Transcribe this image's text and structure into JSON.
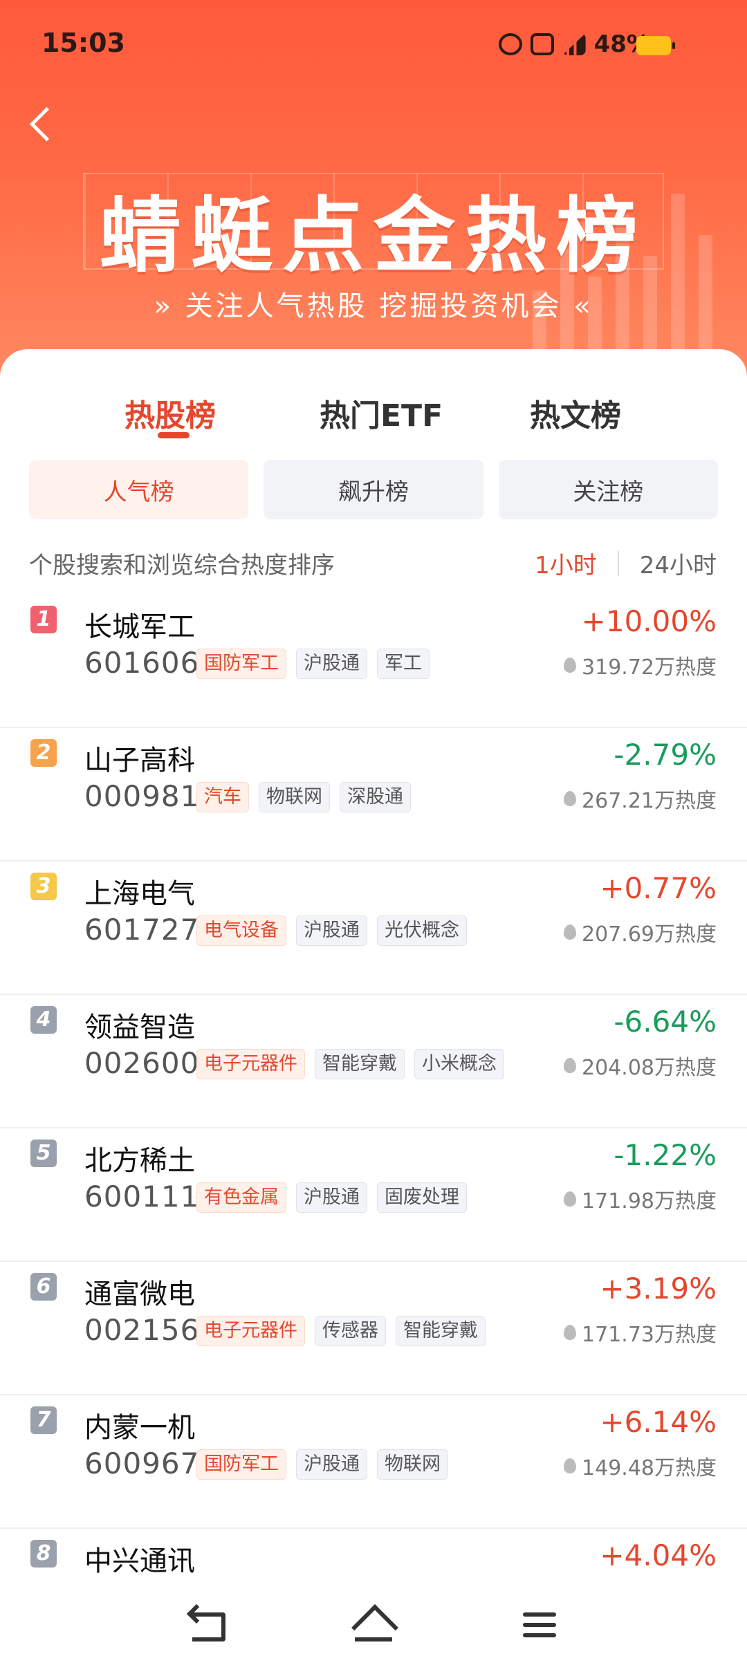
{
  "status_bar": {
    "time": "15:03",
    "battery": "48%",
    "icons": [
      "alarm-icon",
      "hd-icon",
      "4g-signal-icon",
      "battery-icon"
    ]
  },
  "banner": {
    "title": "蜻蜓点金热榜",
    "subtitle": "» 关注人气热股 挖掘投资机会 «"
  },
  "main_tabs": [
    {
      "label": "热股榜",
      "active": true
    },
    {
      "label": "热门ETF",
      "active": false
    },
    {
      "label": "热文榜",
      "active": false
    }
  ],
  "sub_tabs": [
    {
      "label": "人气榜",
      "active": true
    },
    {
      "label": "飙升榜",
      "active": false
    },
    {
      "label": "关注榜",
      "active": false
    }
  ],
  "description": "个股搜索和浏览综合热度排序",
  "time_range": {
    "options": [
      "1小时",
      "24小时"
    ],
    "selected": "1小时"
  },
  "accent_color": "#e5472d",
  "up_color": "#e5472d",
  "down_color": "#1a9c5b",
  "stocks": [
    {
      "rank": "1",
      "rank_color": "#f0606e",
      "name": "长城军工",
      "code": "601606",
      "tags": [
        "国防军工",
        "沪股通",
        "军工"
      ],
      "hot_tags": [
        0
      ],
      "change": "+10.00%",
      "direction": "up",
      "heat": "319.72万热度"
    },
    {
      "rank": "2",
      "rank_color": "#f7a24c",
      "name": "山子高科",
      "code": "000981",
      "tags": [
        "汽车",
        "物联网",
        "深股通"
      ],
      "hot_tags": [
        0
      ],
      "change": "-2.79%",
      "direction": "down",
      "heat": "267.21万热度"
    },
    {
      "rank": "3",
      "rank_color": "#f5c84a",
      "name": "上海电气",
      "code": "601727",
      "tags": [
        "电气设备",
        "沪股通",
        "光伏概念"
      ],
      "hot_tags": [
        0
      ],
      "change": "+0.77%",
      "direction": "up",
      "heat": "207.69万热度"
    },
    {
      "rank": "4",
      "rank_color": "#9aa1ad",
      "name": "领益智造",
      "code": "002600",
      "tags": [
        "电子元器件",
        "智能穿戴",
        "小米概念"
      ],
      "hot_tags": [
        0
      ],
      "change": "-6.64%",
      "direction": "down",
      "heat": "204.08万热度"
    },
    {
      "rank": "5",
      "rank_color": "#9aa1ad",
      "name": "北方稀土",
      "code": "600111",
      "tags": [
        "有色金属",
        "沪股通",
        "固废处理"
      ],
      "hot_tags": [
        0
      ],
      "change": "-1.22%",
      "direction": "down",
      "heat": "171.98万热度"
    },
    {
      "rank": "6",
      "rank_color": "#9aa1ad",
      "name": "通富微电",
      "code": "002156",
      "tags": [
        "电子元器件",
        "传感器",
        "智能穿戴"
      ],
      "hot_tags": [
        0
      ],
      "change": "+3.19%",
      "direction": "up",
      "heat": "171.73万热度"
    },
    {
      "rank": "7",
      "rank_color": "#9aa1ad",
      "name": "内蒙一机",
      "code": "600967",
      "tags": [
        "国防军工",
        "沪股通",
        "物联网"
      ],
      "hot_tags": [
        0
      ],
      "change": "+6.14%",
      "direction": "up",
      "heat": "149.48万热度"
    },
    {
      "rank": "8",
      "rank_color": "#9aa1ad",
      "name": "中兴通讯",
      "code": "",
      "tags": [],
      "hot_tags": [],
      "change": "+4.04%",
      "direction": "up",
      "heat": ""
    }
  ],
  "nav_bar": {
    "icons": [
      "back-icon",
      "home-icon",
      "menu-icon"
    ]
  }
}
